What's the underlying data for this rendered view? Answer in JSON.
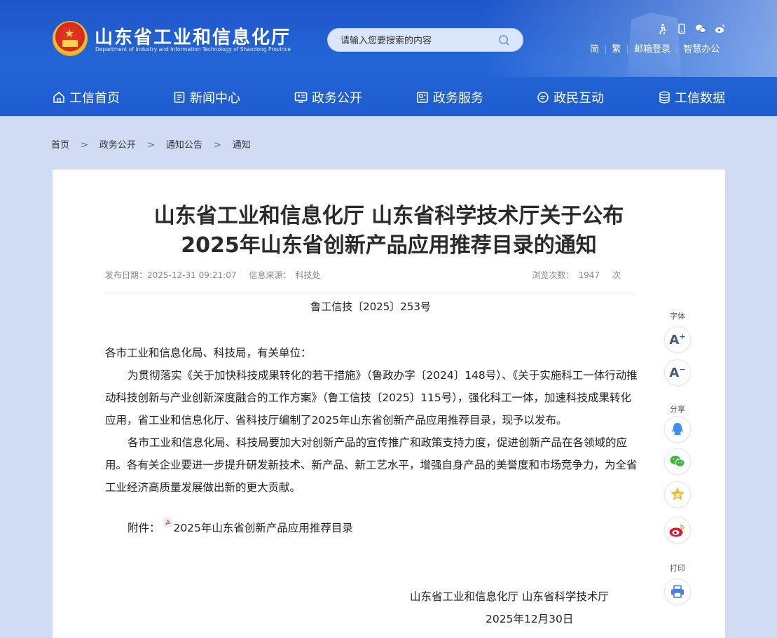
{
  "header": {
    "site_title": "山东省工业和信息化厅",
    "site_subtitle": "Department of Industry and Information Technology of Shandong Province",
    "search_placeholder": "请输入您要搜索的内容",
    "links": [
      "简",
      "繁",
      "邮箱登录",
      "智慧办公"
    ],
    "tool_icons": [
      "accessibility-icon",
      "mobile-icon",
      "wechat-icon",
      "weibo-icon"
    ],
    "colors": {
      "header_blue": "#2466d6",
      "page_bg": "#cfdcf3"
    }
  },
  "nav": [
    {
      "label": "工信首页",
      "icon": "home-icon"
    },
    {
      "label": "新闻中心",
      "icon": "news-icon"
    },
    {
      "label": "政务公开",
      "icon": "gov-open-icon"
    },
    {
      "label": "政务服务",
      "icon": "service-icon"
    },
    {
      "label": "政民互动",
      "icon": "chat-icon"
    },
    {
      "label": "工信数据",
      "icon": "database-icon"
    }
  ],
  "breadcrumb": [
    "首页",
    "政务公开",
    "通知公告",
    "通知"
  ],
  "breadcrumb_sep": ">",
  "article": {
    "title_line1": "山东省工业和信息化厅 山东省科学技术厅关于公布",
    "title_line2": "2025年山东省创新产品应用推荐目录的通知",
    "date_label": "发布日期：",
    "date_value": "2025-12-31 09:21:07",
    "source_label": "信息来源：",
    "source_value": "科技处",
    "views_label": "浏览次数：",
    "views_value": "1947",
    "views_unit": "次",
    "doc_number": "鲁工信技〔2025〕253号",
    "salutation": "各市工业和信息化局、科技局，有关单位：",
    "para1": "为贯彻落实《关于加快科技成果转化的若干措施》（鲁政办字〔2024〕148号）、《关于实施科工一体行动推动科技创新与产业创新深度融合的工作方案》（鲁工信技〔2025〕115号），强化科工一体，加速科技成果转化应用，省工业和信息化厅、省科技厅编制了2025年山东省创新产品应用推荐目录，现予以发布。",
    "para2": "各市工业和信息化局、科技局要加大对创新产品的宣传推广和政策支持力度，促进创新产品在各领域的应用。各有关企业要进一步提升研发新技术、新产品、新工艺水平，增强自身产品的美誉度和市场竞争力，为全省工业经济高质量发展做出新的更大贡献。",
    "attachment_label": "附件：",
    "attachment_name": "2025年山东省创新产品应用推荐目录",
    "signature": "山东省工业和信息化厅 山东省科学技术厅",
    "sign_date": "2025年12月30日"
  },
  "side_panel": {
    "font_label": "字体",
    "font_increase": "A",
    "font_decrease": "A",
    "share_label": "分享",
    "share_icons": [
      "qq-icon",
      "wechat-icon",
      "qzone-icon",
      "weibo-icon"
    ],
    "print_label": "打印"
  }
}
